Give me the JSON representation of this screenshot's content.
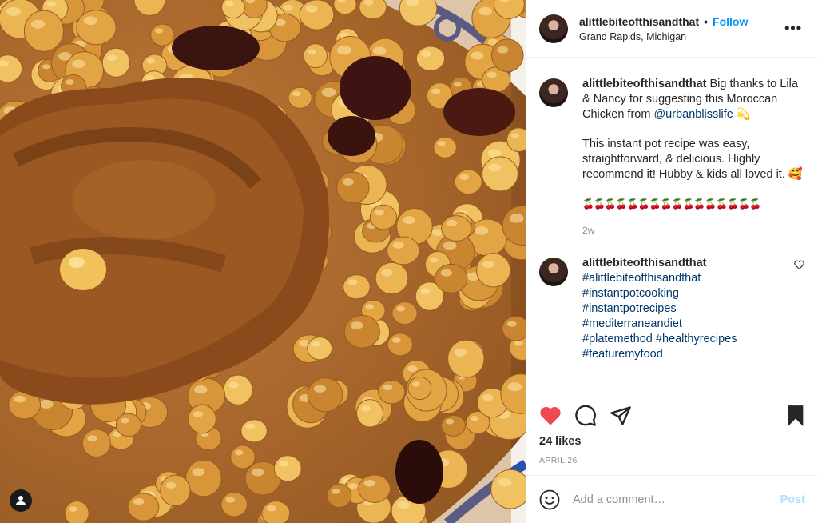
{
  "post": {
    "image_alt": "Moroccan chicken with chickpeas",
    "user_tag_icon": "person-icon"
  },
  "header": {
    "username": "alittlebiteofthisandthat",
    "dot": "•",
    "follow_label": "Follow",
    "location": "Grand Rapids, Michigan",
    "more_label": "•••"
  },
  "caption": {
    "username": "alittlebiteofthisandthat",
    "text1": "Big thanks to Lila & Nancy for suggesting this Moroccan Chicken from",
    "mention": "@urbanblisslife",
    "emoji1": "💫",
    "text2": "This instant pot recipe was easy, straightforward, & delicious. Highly recommend it! Hubby & kids all loved it.",
    "emoji2": "🥰",
    "cherries": "🍒🍒🍒🍒🍒🍒🍒🍒🍒🍒🍒🍒🍒🍒🍒🍒",
    "age": "2w"
  },
  "comment": {
    "username": "alittlebiteofthisandthat",
    "tags": [
      "#alittlebiteofthisandthat",
      "#instantpotcooking",
      "#instantpotrecipes",
      "#mediterraneandiet",
      "#platemethod",
      "#healthyrecipes",
      "#featuremyfood"
    ]
  },
  "actions": {
    "like_icon": "heart-filled-icon",
    "comment_icon": "comment-icon",
    "share_icon": "paper-plane-icon",
    "save_icon": "bookmark-icon",
    "like_color": "#ed4956"
  },
  "likes": "24 likes",
  "date": "APRIL 26",
  "add_comment": {
    "placeholder": "Add a comment…",
    "post_label": "Post"
  }
}
